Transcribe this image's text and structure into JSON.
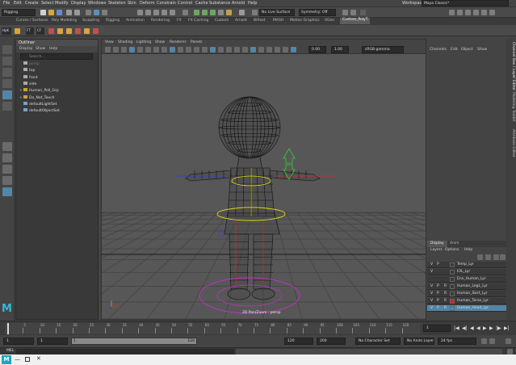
{
  "menubar": {
    "items": [
      "File",
      "Edit",
      "Create",
      "Select",
      "Modify",
      "Display",
      "Windows",
      "Skeleton",
      "Skin",
      "Deform",
      "Constrain",
      "Control",
      "Cache",
      "Substance",
      "Arnold",
      "Help"
    ],
    "workspace_label": "Workspace :",
    "workspace_value": "Maya Classic*"
  },
  "statusline": {
    "mode": "Rigging",
    "live_surface": "No Live Surface",
    "symmetry": "Symmetry: Off"
  },
  "shelf": {
    "tabs": [
      "Curves / Surfaces",
      "Poly Modeling",
      "Sculpting",
      "Rigging",
      "Animation",
      "Rendering",
      "FX",
      "FX Caching",
      "Custom",
      "Arnold",
      "Bifrost",
      "MASH",
      "Motion Graphics",
      "XGen",
      "Custom_PolyT"
    ],
    "active_tab": "Custom_PolyT",
    "left_labels": [
      "HpK",
      "FT",
      "CF"
    ]
  },
  "outliner": {
    "title": "Outliner",
    "menu": [
      "Display",
      "Show",
      "Help"
    ],
    "search_placeholder": "Search...",
    "items": [
      {
        "label": "persp",
        "expand": "",
        "dim": true
      },
      {
        "label": "top",
        "expand": "",
        "dim": false
      },
      {
        "label": "front",
        "expand": "",
        "dim": false
      },
      {
        "label": "side",
        "expand": "",
        "dim": false
      },
      {
        "label": "Human_Poll_Grp",
        "expand": "+",
        "dim": false
      },
      {
        "label": "Do_Not_Touch",
        "expand": "+",
        "dim": false
      },
      {
        "label": "defaultLightSet",
        "expand": "",
        "dim": false
      },
      {
        "label": "defaultObjectSet",
        "expand": "",
        "dim": false
      }
    ]
  },
  "viewport": {
    "menu": [
      "View",
      "Shading",
      "Lighting",
      "Show",
      "Renderer",
      "Panels"
    ],
    "field_a": "0.00",
    "field_b": "1.00",
    "color_space": "sRGB gamma",
    "camera_label": "2D Pan/Zoom : persp"
  },
  "channel_box": {
    "menu": [
      "Channels",
      "Edit",
      "Object",
      "Show"
    ]
  },
  "layer_editor": {
    "tabs": [
      "Display",
      "Anim"
    ],
    "menu": [
      "Layers",
      "Options",
      "Help"
    ],
    "layers": [
      {
        "v": "V",
        "p": "P",
        "r": "",
        "swatch": "",
        "name": "Temp_Lyr",
        "selected": false
      },
      {
        "v": "V",
        "p": "",
        "r": "",
        "swatch": "",
        "name": "IOL_Lyr",
        "selected": false
      },
      {
        "v": "",
        "p": "",
        "r": "",
        "swatch": "",
        "name": "Env_Human_Lyr",
        "selected": false
      },
      {
        "v": "V",
        "p": "P",
        "r": "R",
        "swatch": "",
        "name": "Human_LegL_Lyr",
        "selected": false
      },
      {
        "v": "V",
        "p": "P",
        "r": "R",
        "swatch": "",
        "name": "Human_Skirt_Lyr",
        "selected": false
      },
      {
        "v": "V",
        "p": "P",
        "r": "R",
        "swatch": "#d42020",
        "name": "Human_Torso_Lyr",
        "selected": false
      },
      {
        "v": "V",
        "p": "P",
        "r": "R",
        "swatch": "",
        "name": "Human_Head_Lyr",
        "selected": true
      }
    ]
  },
  "sidetabs": [
    "Channel Box / Layer Editor",
    "Modeling Toolkit",
    "Attribute Editor"
  ],
  "timeline": {
    "ticks": [
      "5",
      "10",
      "15",
      "20",
      "25",
      "30",
      "35",
      "40",
      "45",
      "50",
      "55",
      "60",
      "65",
      "70",
      "75",
      "80",
      "85",
      "90",
      "95",
      "100",
      "105",
      "110",
      "115",
      "120"
    ],
    "current_frame": "1"
  },
  "range": {
    "start": "1",
    "start_inner": "1",
    "slider_start": "1",
    "slider_end": "120",
    "end_inner": "120",
    "end": "200",
    "character_set": "No Character Set",
    "anim_layer": "No Anim Layer",
    "fps": "24 fps"
  },
  "cmdline": {
    "label": "MEL"
  },
  "colors": {
    "wire": "#101010",
    "ik_green": "#2fd12f",
    "ctrl_yellow": "#e4e014",
    "ctrl_magenta": "#c42fc8",
    "ctrl_red": "#e02828",
    "ctrl_blue": "#3a3ae0",
    "selection_blue": "#5285a6"
  }
}
